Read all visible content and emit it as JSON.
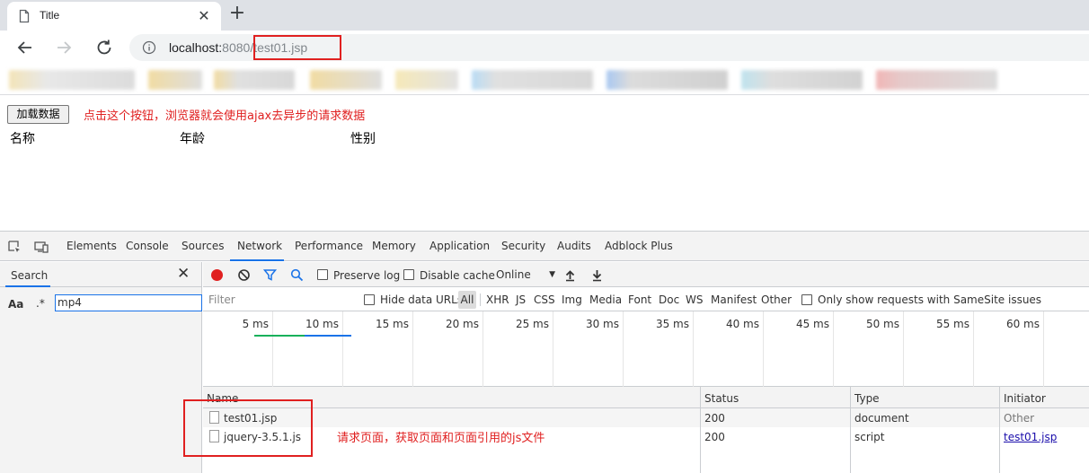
{
  "browser": {
    "tab_title": "Title",
    "tab_close": "✕",
    "new_tab": "+",
    "url_host": "localhost:",
    "url_port": "8080",
    "url_path": "/test01.jsp"
  },
  "page": {
    "load_button": "加载数据",
    "annotation_button": "点击这个按钮，浏览器就会使用ajax去异步的请求数据",
    "columns": [
      "名称",
      "年龄",
      "性别"
    ]
  },
  "devtools": {
    "tabs": [
      "Elements",
      "Console",
      "Sources",
      "Network",
      "Performance",
      "Memory",
      "Application",
      "Security",
      "Audits",
      "Adblock Plus"
    ],
    "active_tab": "Network",
    "search": {
      "tab_label": "Search",
      "close": "✕",
      "case_toggle": "Aa",
      "regex_toggle": ".*",
      "query": "mp4"
    },
    "toolbar": {
      "preserve_log": "Preserve log",
      "disable_cache": "Disable cache",
      "throttle": "Online",
      "throttle_caret": "▼"
    },
    "filter": {
      "placeholder": "Filter",
      "hide_data_urls": "Hide data URLs",
      "all": "All",
      "types": [
        "XHR",
        "JS",
        "CSS",
        "Img",
        "Media",
        "Font",
        "Doc",
        "WS",
        "Manifest",
        "Other"
      ],
      "samesite": "Only show requests with SameSite issues"
    },
    "timeline": {
      "ticks": [
        "5 ms",
        "10 ms",
        "15 ms",
        "20 ms",
        "25 ms",
        "30 ms",
        "35 ms",
        "40 ms",
        "45 ms",
        "50 ms",
        "55 ms",
        "60 ms",
        "6"
      ]
    },
    "grid": {
      "headers": [
        "Name",
        "Status",
        "Type",
        "Initiator"
      ],
      "rows": [
        {
          "name": "test01.jsp",
          "status": "200",
          "type": "document",
          "initiator": "Other"
        },
        {
          "name": "jquery-3.5.1.js",
          "status": "200",
          "type": "script",
          "initiator": "test01.jsp"
        }
      ]
    },
    "annotation_requests": "请求页面，获取页面和页面引用的js文件"
  },
  "colors": {
    "accent": "#1a73e8",
    "annotation": "#e02020",
    "record": "#e02020"
  }
}
